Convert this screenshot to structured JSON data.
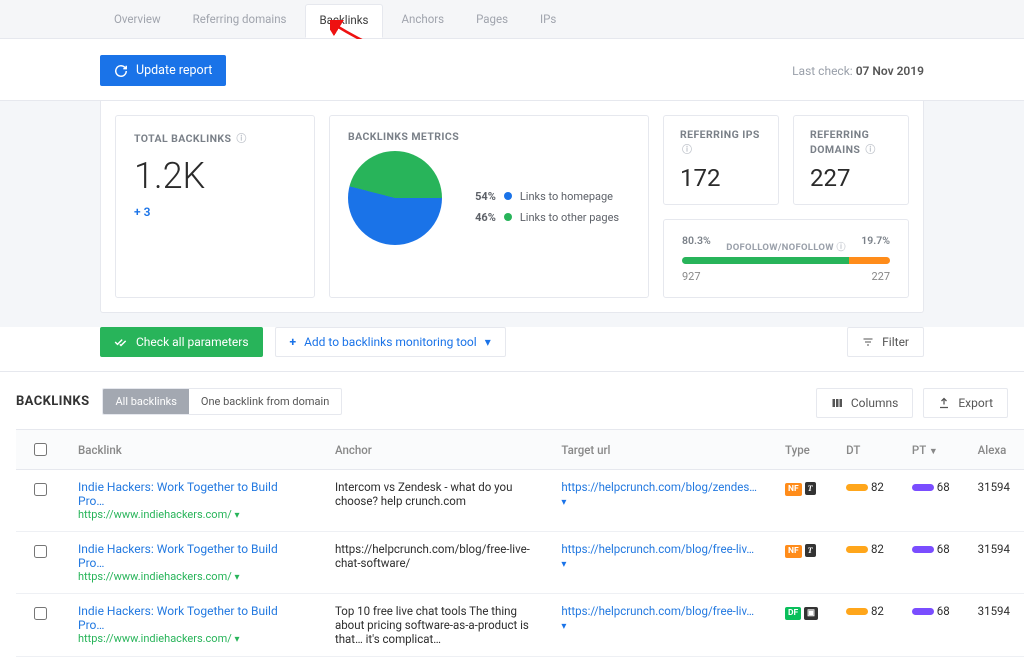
{
  "tabs": [
    "Overview",
    "Referring domains",
    "Backlinks",
    "Anchors",
    "Pages",
    "IPs"
  ],
  "active_tab_index": 2,
  "update_btn": "Update report",
  "last_check_label": "Last check:",
  "last_check_date": "07 Nov 2019",
  "cards": {
    "total": {
      "title": "TOTAL BACKLINKS",
      "value": "1.2K",
      "delta": "+ 3"
    },
    "metrics": {
      "title": "BACKLINKS METRICS",
      "legend": [
        {
          "pct": "54%",
          "label": "Links to homepage",
          "color": "#1a73e8"
        },
        {
          "pct": "46%",
          "label": "Links to other pages",
          "color": "#28b45a"
        }
      ]
    },
    "ips": {
      "title": "REFERRING IPS",
      "value": "172"
    },
    "domains": {
      "title": "REFERRING DOMAINS",
      "value": "227"
    },
    "follow": {
      "left_pct": "80.3%",
      "right_pct": "19.7%",
      "center": "DOFOLLOW/NOFOLLOW",
      "left_n": "927",
      "right_n": "227"
    }
  },
  "toolbar": {
    "check": "Check all parameters",
    "add": "Add to backlinks monitoring tool",
    "filter": "Filter"
  },
  "section": {
    "title": "BACKLINKS",
    "seg_all": "All backlinks",
    "seg_one": "One backlink from domain",
    "columns_btn": "Columns",
    "export_btn": "Export"
  },
  "headers": {
    "backlink": "Backlink",
    "anchor": "Anchor",
    "target": "Target url",
    "type": "Type",
    "dt": "DT",
    "pt": "PT",
    "alexa": "Alexa"
  },
  "rows": [
    {
      "title": "Indie Hackers: Work Together to Build Pro…",
      "domain": "https://www.indiehackers.com/",
      "anchor": "Intercom vs Zendesk - what do you choose? help crunch.com",
      "target": "https://helpcrunch.com/blog/zendes…",
      "type_badge": "NF",
      "type_glyph": "T",
      "dt": "82",
      "pt": "68",
      "alexa": "31594"
    },
    {
      "title": "Indie Hackers: Work Together to Build Pro…",
      "domain": "https://www.indiehackers.com/",
      "anchor": "https://helpcrunch.com/blog/free-live-chat-software/",
      "target": "https://helpcrunch.com/blog/free-liv…",
      "type_badge": "NF",
      "type_glyph": "T",
      "dt": "82",
      "pt": "68",
      "alexa": "31594"
    },
    {
      "title": "Indie Hackers: Work Together to Build Pro…",
      "domain": "https://www.indiehackers.com/",
      "anchor": "Top 10 free live chat tools The thing about pricing software-as-a-product is that… it's complicat…",
      "target": "https://helpcrunch.com/blog/free-liv…",
      "type_badge": "DF",
      "type_glyph": "PIC",
      "dt": "82",
      "pt": "68",
      "alexa": "31594"
    }
  ],
  "chart_data": {
    "type": "pie",
    "title": "Backlinks Metrics",
    "series": [
      {
        "name": "Links to homepage",
        "value": 54,
        "color": "#1a73e8"
      },
      {
        "name": "Links to other pages",
        "value": 46,
        "color": "#28b45a"
      }
    ]
  }
}
